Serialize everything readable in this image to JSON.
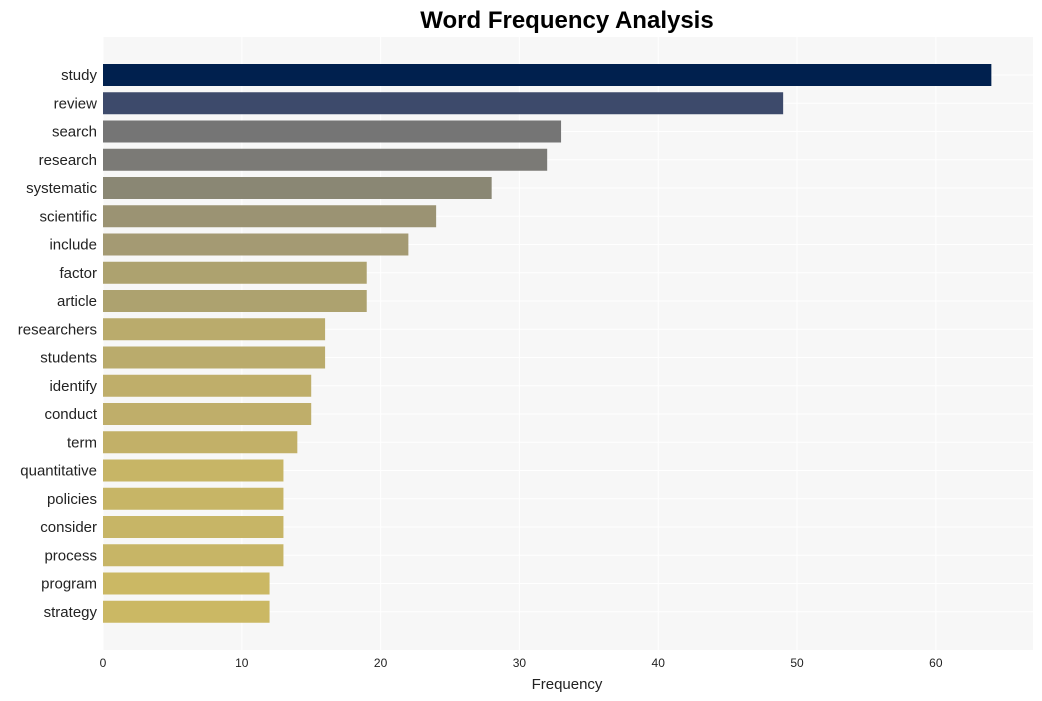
{
  "chart_data": {
    "type": "bar",
    "orientation": "horizontal",
    "title": "Word Frequency Analysis",
    "xlabel": "Frequency",
    "ylabel": "",
    "xlim": [
      0,
      67
    ],
    "xticks": [
      0,
      10,
      20,
      30,
      40,
      50,
      60
    ],
    "grid": true,
    "categories": [
      "study",
      "review",
      "search",
      "research",
      "systematic",
      "scientific",
      "include",
      "factor",
      "article",
      "researchers",
      "students",
      "identify",
      "conduct",
      "term",
      "quantitative",
      "policies",
      "consider",
      "process",
      "program",
      "strategy"
    ],
    "values": [
      64,
      49,
      33,
      32,
      28,
      24,
      22,
      19,
      19,
      16,
      16,
      15,
      15,
      14,
      13,
      13,
      13,
      13,
      12,
      12
    ],
    "colors": [
      "#00204e",
      "#3d4a6b",
      "#757575",
      "#7b7a76",
      "#8a8774",
      "#9b9373",
      "#a49a73",
      "#ada26f",
      "#ada26f",
      "#baab6c",
      "#baab6c",
      "#bfae6a",
      "#bfae6a",
      "#c2b068",
      "#c7b566",
      "#c7b566",
      "#c7b566",
      "#c7b566",
      "#cbb864",
      "#cbb864"
    ],
    "background": "#f7f7f7"
  }
}
